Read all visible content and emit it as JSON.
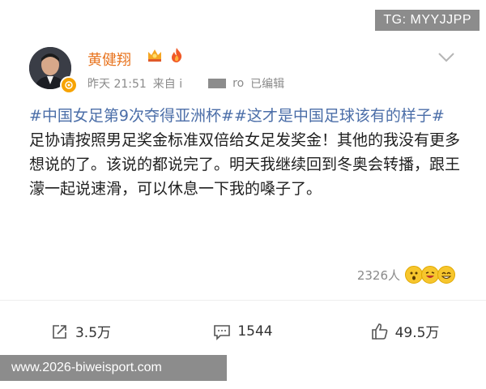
{
  "watermark_top": "TG: MYYJJPP",
  "user": {
    "name": "黄健翔"
  },
  "meta": {
    "time": "昨天 21:51",
    "source_prefix": "来自 i",
    "source_suffix": "ro",
    "edited": "已编辑"
  },
  "post": {
    "hashtag1": "#中国女足第9次夺得亚洲杯#",
    "hashtag2": "#这才是中国足球该有的样子#",
    "body": "足协请按照男足奖金标准双倍给女足发奖金！其他的我没有更多想说的了。该说的都说完了。明天我继续回到冬奥会转播，跟王濛一起说速滑，可以休息一下我的嗓子了。"
  },
  "reactions": {
    "count": "2326人"
  },
  "actions": {
    "repost": "3.5万",
    "comment": "1544",
    "like": "49.5万"
  },
  "watermark_bottom": "www.2026-biweisport.com",
  "colors": {
    "username": "#e8741f",
    "hashtag": "#4b6ea8",
    "watermark": "#8c8c8c"
  }
}
